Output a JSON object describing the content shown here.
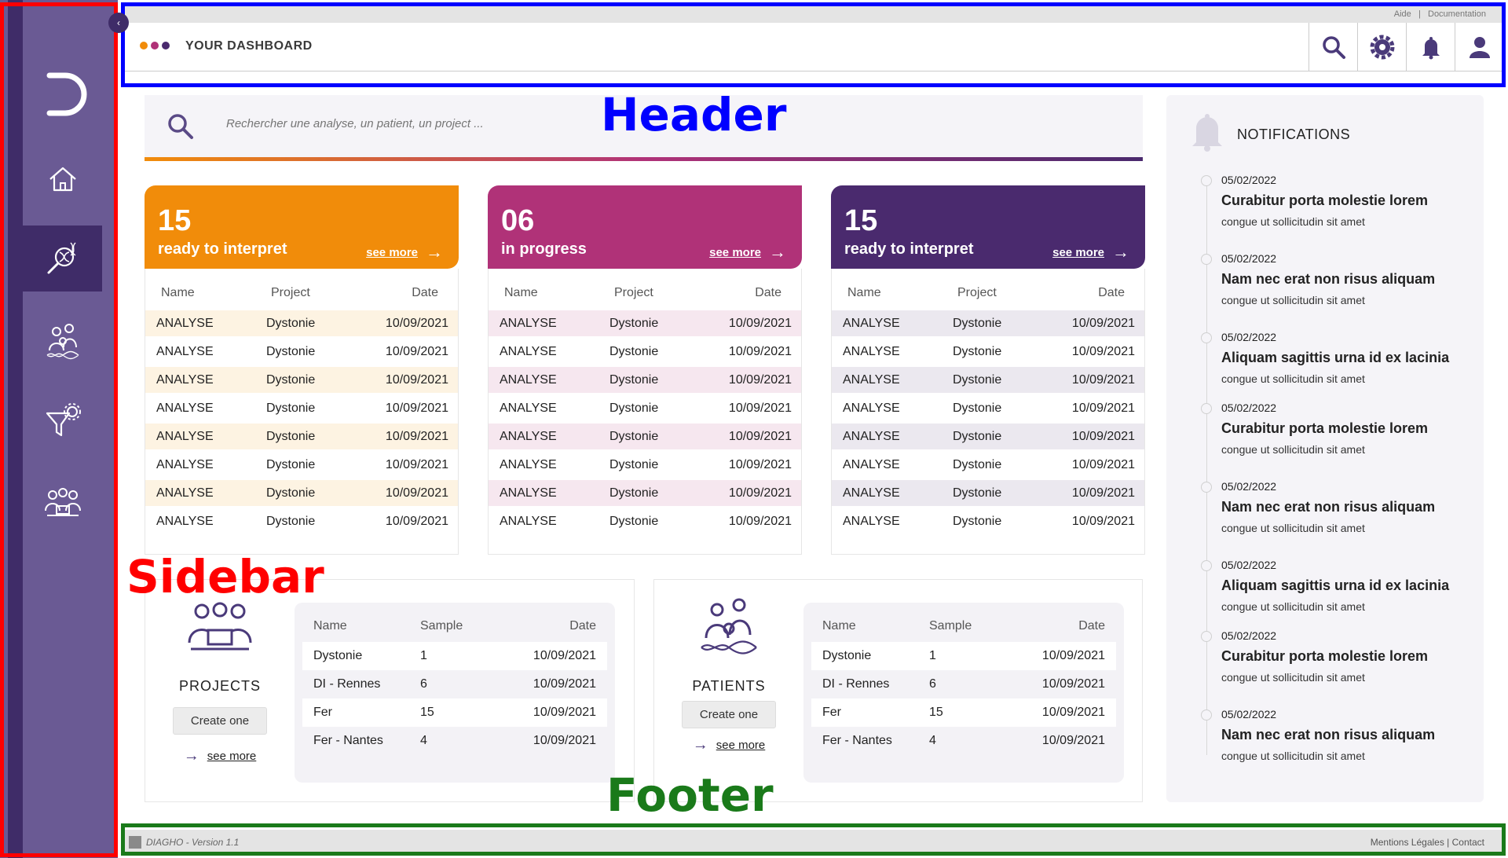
{
  "colors": {
    "sidebar": "#6a5a94",
    "sidebar_dark": "#3f2c68",
    "orange": "#f18c0a",
    "magenta": "#b03278",
    "purple": "#4a2a6e",
    "annot_red": "#ff0000",
    "annot_blue": "#0000ff",
    "annot_green": "#1a7a1a"
  },
  "annotations": {
    "header": "Header",
    "sidebar": "Sidebar",
    "footer": "Footer"
  },
  "sidebar": {
    "collapse_icon": "chevron-left-icon",
    "logo_icon": "d-logo-icon",
    "items": [
      {
        "name": "home",
        "icon": "home-icon"
      },
      {
        "name": "analyses",
        "icon": "dna-magnifier-icon"
      },
      {
        "name": "patients",
        "icon": "family-dna-icon"
      },
      {
        "name": "filters",
        "icon": "funnel-gear-icon"
      },
      {
        "name": "projects",
        "icon": "team-icon"
      }
    ]
  },
  "topbar": {
    "help": "Aide",
    "separator": "|",
    "docs": "Documentation"
  },
  "header": {
    "title": "YOUR DASHBOARD",
    "icons": [
      "search-icon",
      "gear-icon",
      "bell-icon",
      "user-icon"
    ]
  },
  "search": {
    "placeholder": "Rechercher une analyse, un patient, un project ..."
  },
  "cards": [
    {
      "count": "15",
      "label": "ready to interpret",
      "see_more": "see more",
      "color": "#f18c0a",
      "stripe": "#fdf3e2",
      "columns": [
        "Name",
        "Project",
        "Date"
      ],
      "rows": [
        [
          "ANALYSE",
          "Dystonie",
          "10/09/2021"
        ],
        [
          "ANALYSE",
          "Dystonie",
          "10/09/2021"
        ],
        [
          "ANALYSE",
          "Dystonie",
          "10/09/2021"
        ],
        [
          "ANALYSE",
          "Dystonie",
          "10/09/2021"
        ],
        [
          "ANALYSE",
          "Dystonie",
          "10/09/2021"
        ],
        [
          "ANALYSE",
          "Dystonie",
          "10/09/2021"
        ],
        [
          "ANALYSE",
          "Dystonie",
          "10/09/2021"
        ],
        [
          "ANALYSE",
          "Dystonie",
          "10/09/2021"
        ]
      ]
    },
    {
      "count": "06",
      "label": "in progress",
      "see_more": "see more",
      "color": "#b03278",
      "stripe": "#f6e7ef",
      "columns": [
        "Name",
        "Project",
        "Date"
      ],
      "rows": [
        [
          "ANALYSE",
          "Dystonie",
          "10/09/2021"
        ],
        [
          "ANALYSE",
          "Dystonie",
          "10/09/2021"
        ],
        [
          "ANALYSE",
          "Dystonie",
          "10/09/2021"
        ],
        [
          "ANALYSE",
          "Dystonie",
          "10/09/2021"
        ],
        [
          "ANALYSE",
          "Dystonie",
          "10/09/2021"
        ],
        [
          "ANALYSE",
          "Dystonie",
          "10/09/2021"
        ],
        [
          "ANALYSE",
          "Dystonie",
          "10/09/2021"
        ],
        [
          "ANALYSE",
          "Dystonie",
          "10/09/2021"
        ]
      ]
    },
    {
      "count": "15",
      "label": "ready to interpret",
      "see_more": "see more",
      "color": "#4a2a6e",
      "stripe": "#ebe8ef",
      "columns": [
        "Name",
        "Project",
        "Date"
      ],
      "rows": [
        [
          "ANALYSE",
          "Dystonie",
          "10/09/2021"
        ],
        [
          "ANALYSE",
          "Dystonie",
          "10/09/2021"
        ],
        [
          "ANALYSE",
          "Dystonie",
          "10/09/2021"
        ],
        [
          "ANALYSE",
          "Dystonie",
          "10/09/2021"
        ],
        [
          "ANALYSE",
          "Dystonie",
          "10/09/2021"
        ],
        [
          "ANALYSE",
          "Dystonie",
          "10/09/2021"
        ],
        [
          "ANALYSE",
          "Dystonie",
          "10/09/2021"
        ],
        [
          "ANALYSE",
          "Dystonie",
          "10/09/2021"
        ]
      ]
    }
  ],
  "projects": {
    "title": "PROJECTS",
    "create": "Create one",
    "see_more": "see more",
    "columns": [
      "Name",
      "Sample",
      "Date"
    ],
    "rows": [
      [
        "Dystonie",
        "1",
        "10/09/2021"
      ],
      [
        "DI - Rennes",
        "6",
        "10/09/2021"
      ],
      [
        "Fer",
        "15",
        "10/09/2021"
      ],
      [
        "Fer - Nantes",
        "4",
        "10/09/2021"
      ]
    ]
  },
  "patients": {
    "title": "PATIENTS",
    "create": "Create one",
    "see_more": "see more",
    "columns": [
      "Name",
      "Sample",
      "Date"
    ],
    "rows": [
      [
        "Dystonie",
        "1",
        "10/09/2021"
      ],
      [
        "DI - Rennes",
        "6",
        "10/09/2021"
      ],
      [
        "Fer",
        "15",
        "10/09/2021"
      ],
      [
        "Fer - Nantes",
        "4",
        "10/09/2021"
      ]
    ]
  },
  "notifications": {
    "title": "NOTIFICATIONS",
    "items": [
      {
        "date": "05/02/2022",
        "title": "Curabitur porta molestie lorem",
        "sub": "congue ut sollicitudin sit amet"
      },
      {
        "date": "05/02/2022",
        "title": "Nam nec erat non risus aliquam",
        "sub": "congue ut sollicitudin sit amet"
      },
      {
        "date": "05/02/2022",
        "title": "Aliquam sagittis urna id ex lacinia",
        "sub": "congue ut sollicitudin sit amet"
      },
      {
        "date": "05/02/2022",
        "title": "Curabitur porta molestie lorem",
        "sub": "congue ut sollicitudin sit amet"
      },
      {
        "date": "05/02/2022",
        "title": "Nam nec erat non risus aliquam",
        "sub": "congue ut sollicitudin sit amet"
      },
      {
        "date": "05/02/2022",
        "title": "Aliquam sagittis urna id ex lacinia",
        "sub": "congue ut sollicitudin sit amet"
      },
      {
        "date": "05/02/2022",
        "title": "Curabitur porta molestie lorem",
        "sub": "congue ut sollicitudin sit amet"
      },
      {
        "date": "05/02/2022",
        "title": "Nam nec erat non risus aliquam",
        "sub": "congue ut sollicitudin sit amet"
      }
    ]
  },
  "footer": {
    "version": "DIAGHO - Version 1.1",
    "legal": "Mentions Légales",
    "separator": "|",
    "contact": "Contact"
  }
}
